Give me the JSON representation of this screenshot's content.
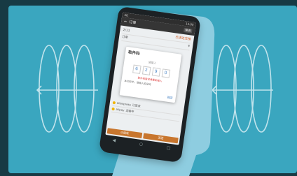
{
  "colors": {
    "background": "#173a44",
    "panel": "#3aa6bf",
    "device": "#1c2124",
    "handset": "#8ecde0",
    "accent": "#c8762e"
  },
  "icons": {
    "wave_left": "nfc-waves-icon",
    "wave_right": "nfc-waves-icon",
    "back": "back-icon",
    "home": "home-icon",
    "recent": "recent-apps-icon"
  },
  "phone": {
    "status_left": "4G",
    "status_right": "13:00",
    "app_title": "订单",
    "app_button": "筛选",
    "row1_left": "2/11",
    "row1_right": "已送达交接",
    "row2_left": "订单",
    "row2_right": "¥",
    "dialog": {
      "title": "取件码",
      "subtitle": "请输入",
      "digits": [
        "6",
        "2",
        "9",
        "0"
      ],
      "warning": "取件码错误请重新输入",
      "note": "本次取件，请输入验证码",
      "ok": "确定"
    },
    "list": [
      {
        "label": "aliexpress",
        "sub": "已签收"
      },
      {
        "label": "alipay",
        "sub": "运输中"
      }
    ],
    "bottom_left": "已揽收",
    "bottom_right": "派送"
  }
}
